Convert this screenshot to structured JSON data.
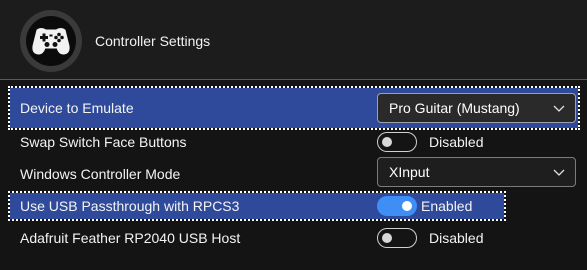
{
  "header": {
    "title": "Controller Settings",
    "icon": "gamepad-icon"
  },
  "settings": [
    {
      "label": "Device to Emulate",
      "control": "select",
      "value": "Pro Guitar (Mustang)"
    },
    {
      "label": "Swap Switch Face Buttons",
      "control": "toggle",
      "state": false,
      "value": "Disabled"
    },
    {
      "label": "Windows Controller Mode",
      "control": "select",
      "value": "XInput"
    },
    {
      "label": "Use USB Passthrough with RPCS3",
      "control": "toggle",
      "state": true,
      "value": "Enabled"
    },
    {
      "label": "Adafruit Feather RP2040 USB Host",
      "control": "toggle",
      "state": false,
      "value": "Disabled"
    }
  ],
  "colors": {
    "selection": "#2f4a9a",
    "toggle_on": "#3f8ef5",
    "background": "#141414"
  }
}
